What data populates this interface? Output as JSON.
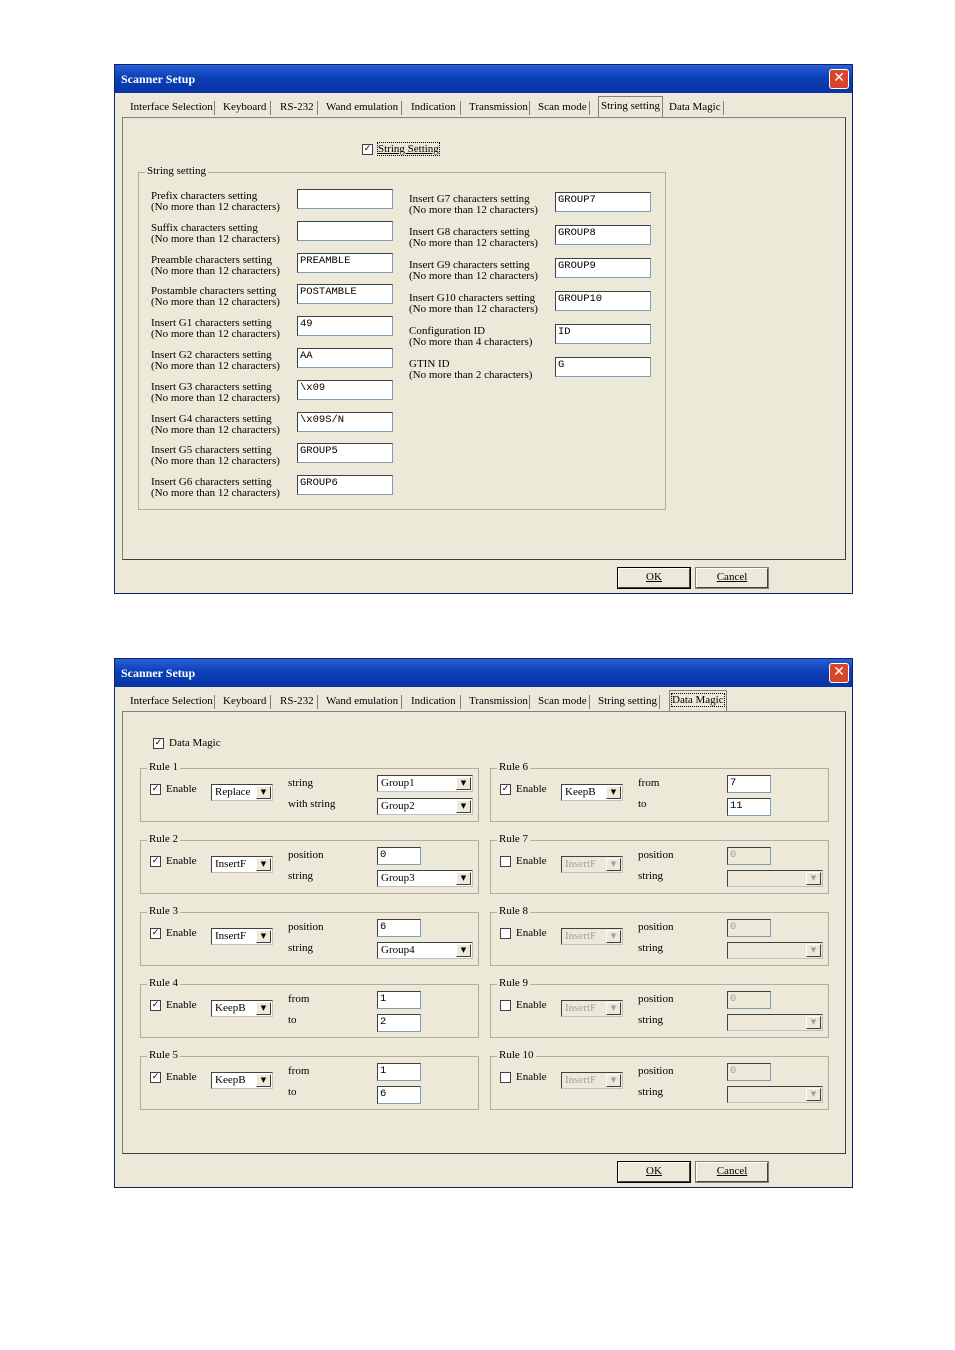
{
  "window_title": "Scanner Setup",
  "tabs": [
    "Interface Selection",
    "Keyboard",
    "RS-232",
    "Wand emulation",
    "Indication",
    "Transmission",
    "Scan mode",
    "String setting",
    "Data Magic"
  ],
  "ok_label": "OK",
  "cancel_label": "Cancel",
  "string_dialog": {
    "enable_label": "String Setting",
    "group_label": "String setting",
    "left_fields": [
      {
        "l1": "Prefix characters setting",
        "l2": "(No  more than 12 characters)",
        "value": ""
      },
      {
        "l1": "Suffix characters setting",
        "l2": "(No  more than 12 characters)",
        "value": ""
      },
      {
        "l1": "Preamble characters setting",
        "l2": "(No  more than 12 characters)",
        "value": "PREAMBLE"
      },
      {
        "l1": "Postamble characters setting",
        "l2": "(No  more than 12 characters)",
        "value": "POSTAMBLE"
      },
      {
        "l1": "Insert G1 characters setting",
        "l2": "(No  more than 12 characters)",
        "value": "49"
      },
      {
        "l1": "Insert G2 characters setting",
        "l2": "(No  more than 12 characters)",
        "value": "AA"
      },
      {
        "l1": "Insert G3 characters setting",
        "l2": "(No  more than 12 characters)",
        "value": "\\x09"
      },
      {
        "l1": "Insert G4 characters setting",
        "l2": "(No  more than 12 characters)",
        "value": "\\x09S/N"
      },
      {
        "l1": "Insert G5 characters setting",
        "l2": "(No  more than 12 characters)",
        "value": "GROUP5"
      },
      {
        "l1": "Insert G6 characters setting",
        "l2": "(No  more than 12 characters)",
        "value": "GROUP6"
      }
    ],
    "right_fields": [
      {
        "l1": "Insert G7 characters setting",
        "l2": "(No  more than 12 characters)",
        "value": "GROUP7"
      },
      {
        "l1": "Insert G8 characters setting",
        "l2": "(No  more than 12 characters)",
        "value": "GROUP8"
      },
      {
        "l1": "Insert G9 characters setting",
        "l2": "(No  more than 12 characters)",
        "value": "GROUP9"
      },
      {
        "l1": "Insert G10 characters setting",
        "l2": " (No  more than 12 characters)",
        "value": "GROUP10"
      },
      {
        "l1": "Configuration ID",
        "l2": "(No more than 4 characters)",
        "value": "ID"
      },
      {
        "l1": "GTIN ID",
        "l2": "(No  more than 2 characters)",
        "value": "G"
      }
    ]
  },
  "magic_dialog": {
    "enable_label": "Data Magic",
    "enable_rule_label": "Enable",
    "rules": [
      {
        "name": "Rule 1",
        "enabled": true,
        "mode": "Replace",
        "p1": "string",
        "p2": "with string",
        "v1": "Group1",
        "v2": "Group2",
        "kind": "combo-combo"
      },
      {
        "name": "Rule 2",
        "enabled": true,
        "mode": "InsertF",
        "p1": "position",
        "p2": "string",
        "v1": "0",
        "v2": "Group3",
        "kind": "text-combo"
      },
      {
        "name": "Rule 3",
        "enabled": true,
        "mode": "InsertF",
        "p1": "position",
        "p2": "string",
        "v1": "6",
        "v2": "Group4",
        "kind": "text-combo"
      },
      {
        "name": "Rule 4",
        "enabled": true,
        "mode": "KeepB",
        "p1": "from",
        "p2": "to",
        "v1": "1",
        "v2": "2",
        "kind": "text-text"
      },
      {
        "name": "Rule 5",
        "enabled": true,
        "mode": "KeepB",
        "p1": "from",
        "p2": "to",
        "v1": "1",
        "v2": "6",
        "kind": "text-text"
      },
      {
        "name": "Rule 6",
        "enabled": true,
        "mode": "KeepB",
        "p1": "from",
        "p2": "to",
        "v1": "7",
        "v2": "11",
        "kind": "text-text"
      },
      {
        "name": "Rule 7",
        "enabled": false,
        "mode": "InsertF",
        "p1": "position",
        "p2": "string",
        "v1": "0",
        "v2": "",
        "kind": "text-combo"
      },
      {
        "name": "Rule 8",
        "enabled": false,
        "mode": "InsertF",
        "p1": "position",
        "p2": "string",
        "v1": "0",
        "v2": "",
        "kind": "text-combo"
      },
      {
        "name": "Rule 9",
        "enabled": false,
        "mode": "InsertF",
        "p1": "position",
        "p2": "string",
        "v1": "0",
        "v2": "",
        "kind": "text-combo"
      },
      {
        "name": "Rule 10",
        "enabled": false,
        "mode": "InsertF",
        "p1": "position",
        "p2": "string",
        "v1": "0",
        "v2": "",
        "kind": "text-combo"
      }
    ]
  }
}
